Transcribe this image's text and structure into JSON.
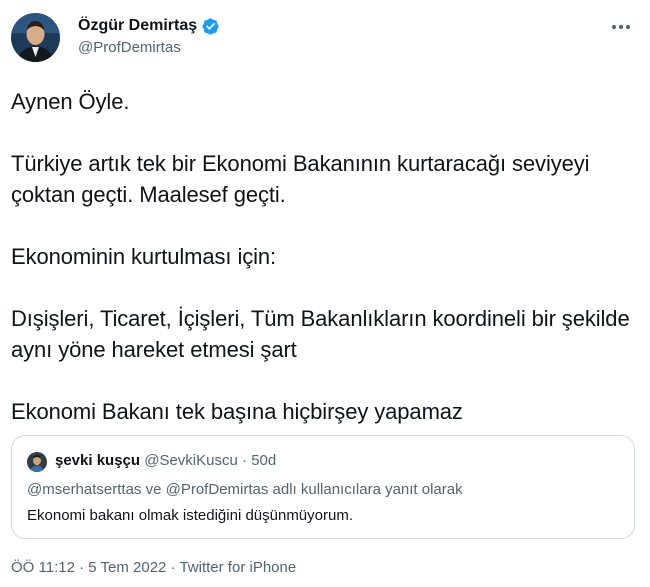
{
  "author": {
    "name": "Özgür Demirtaş",
    "handle": "@ProfDemirtas",
    "verified": true,
    "verified_icon": "verified-badge-icon",
    "avatar_icon": "profile-avatar"
  },
  "menu": {
    "icon": "more-options-icon"
  },
  "tweet": {
    "paragraphs": [
      "Aynen Öyle.",
      "Türkiye artık tek bir Ekonomi Bakanının kurtaracağı seviyeyi çoktan geçti. Maalesef geçti.",
      "Ekonominin kurtulması için:",
      "Dışişleri, Ticaret, İçişleri, Tüm Bakanlıkların koordineli bir şekilde aynı yöne hareket etmesi şart",
      "Ekonomi Bakanı tek başına hiçbirşey yapamaz"
    ]
  },
  "quoted": {
    "name": "şevki kuşçu",
    "handle": "@SevkiKuscu",
    "separator": " · ",
    "age": "50d",
    "reply_to": "@mserhatserttas ve @ProfDemirtas adlı kullanıcılara yanıt olarak",
    "text": "Ekonomi bakanı olmak istediğini düşünmüyorum."
  },
  "meta": {
    "time": "ÖÖ 11:12",
    "separator1": " · ",
    "date": "5 Tem 2022",
    "separator2": " · ",
    "source": "Twitter for iPhone"
  },
  "colors": {
    "text": "#0f1419",
    "secondary": "#536471",
    "border": "#cfd9de",
    "verified": "#1d9bf0"
  }
}
